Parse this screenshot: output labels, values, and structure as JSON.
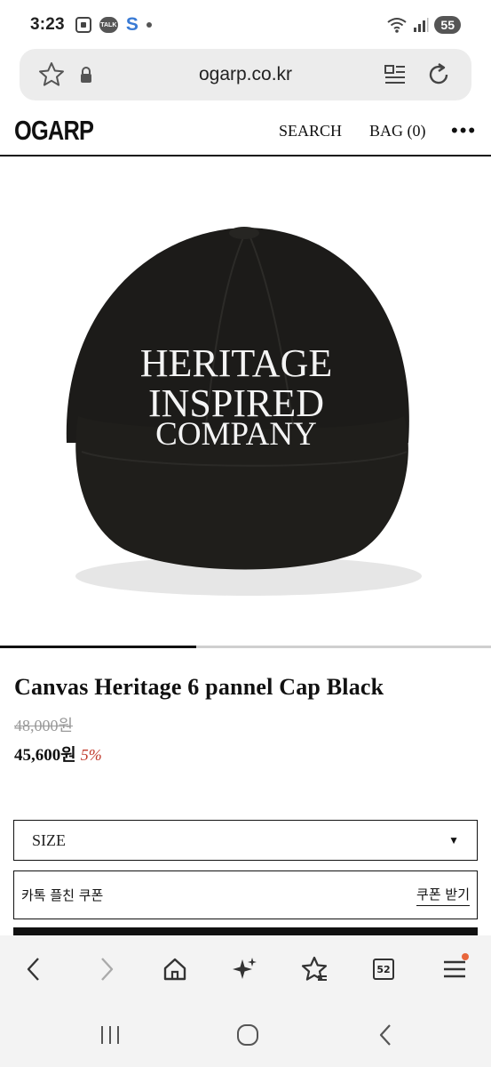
{
  "status_bar": {
    "time": "3:23",
    "battery": "55",
    "talk_badge": "TALK",
    "s_badge": "S"
  },
  "browser": {
    "url": "ogarp.co.kr",
    "tabs_count": "52"
  },
  "header": {
    "logo": "OGARP",
    "search": "SEARCH",
    "bag": "BAG (0)",
    "more": "•••"
  },
  "product": {
    "image": {
      "cap_text_line1": "HERITAGE",
      "cap_text_line2": "INSPIRED",
      "cap_text_line3": "COMPANY",
      "slide_progress": 0.4
    },
    "title": "Canvas Heritage 6 pannel Cap Black",
    "original_price": "48,000원",
    "sale_price": "45,600원",
    "discount": "5%"
  },
  "options": {
    "size_label": "SIZE",
    "coupon_label": "카톡 플친 쿠폰",
    "coupon_button": "쿠폰 받기"
  },
  "colors": {
    "accent_discount": "#c0392b",
    "notification_dot": "#e8663c"
  }
}
